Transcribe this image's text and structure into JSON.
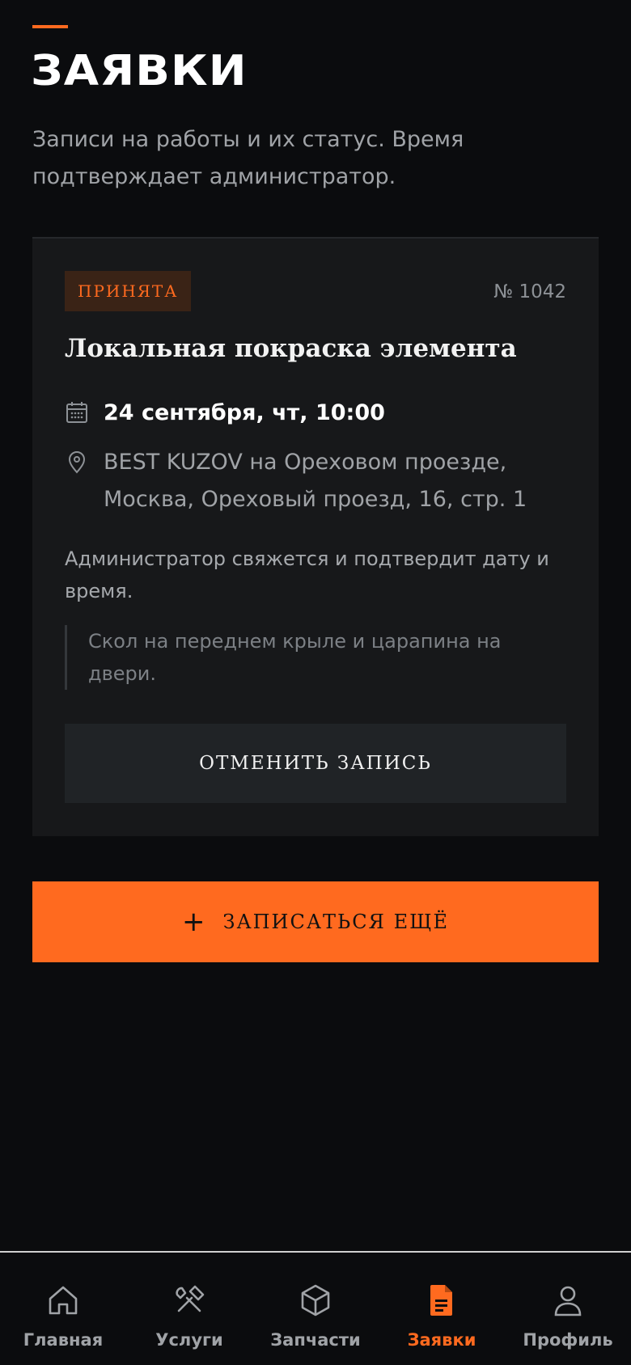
{
  "page": {
    "title": "ЗАЯВКИ",
    "subtitle": "Записи на работы и их статус. Время подтверждает администратор."
  },
  "booking": {
    "status": "ПРИНЯТА",
    "number": "№ 1042",
    "service": "Локальная покраска элемента",
    "datetime": "24 сентября, чт, 10:00",
    "address": "BEST KUZOV на Ореховом проезде, Москва, Ореховый проезд, 16, стр. 1",
    "admin_note": "Администратор свяжется и подтвердит дату и время.",
    "comment": "Скол на переднем крыле и царапина на двери.",
    "cancel_label": "ОТМЕНИТЬ ЗАПИСЬ"
  },
  "actions": {
    "book_more_label": "ЗАПИСАТЬСЯ ЕЩЁ"
  },
  "nav": {
    "items": [
      {
        "label": "Главная",
        "icon": "home-icon"
      },
      {
        "label": "Услуги",
        "icon": "tools-icon"
      },
      {
        "label": "Запчасти",
        "icon": "box-icon"
      },
      {
        "label": "Заявки",
        "icon": "document-icon",
        "active": true
      },
      {
        "label": "Профиль",
        "icon": "user-icon"
      }
    ]
  },
  "colors": {
    "accent": "#ff6a1f",
    "background": "#0b0c0e",
    "card": "#17181a"
  }
}
